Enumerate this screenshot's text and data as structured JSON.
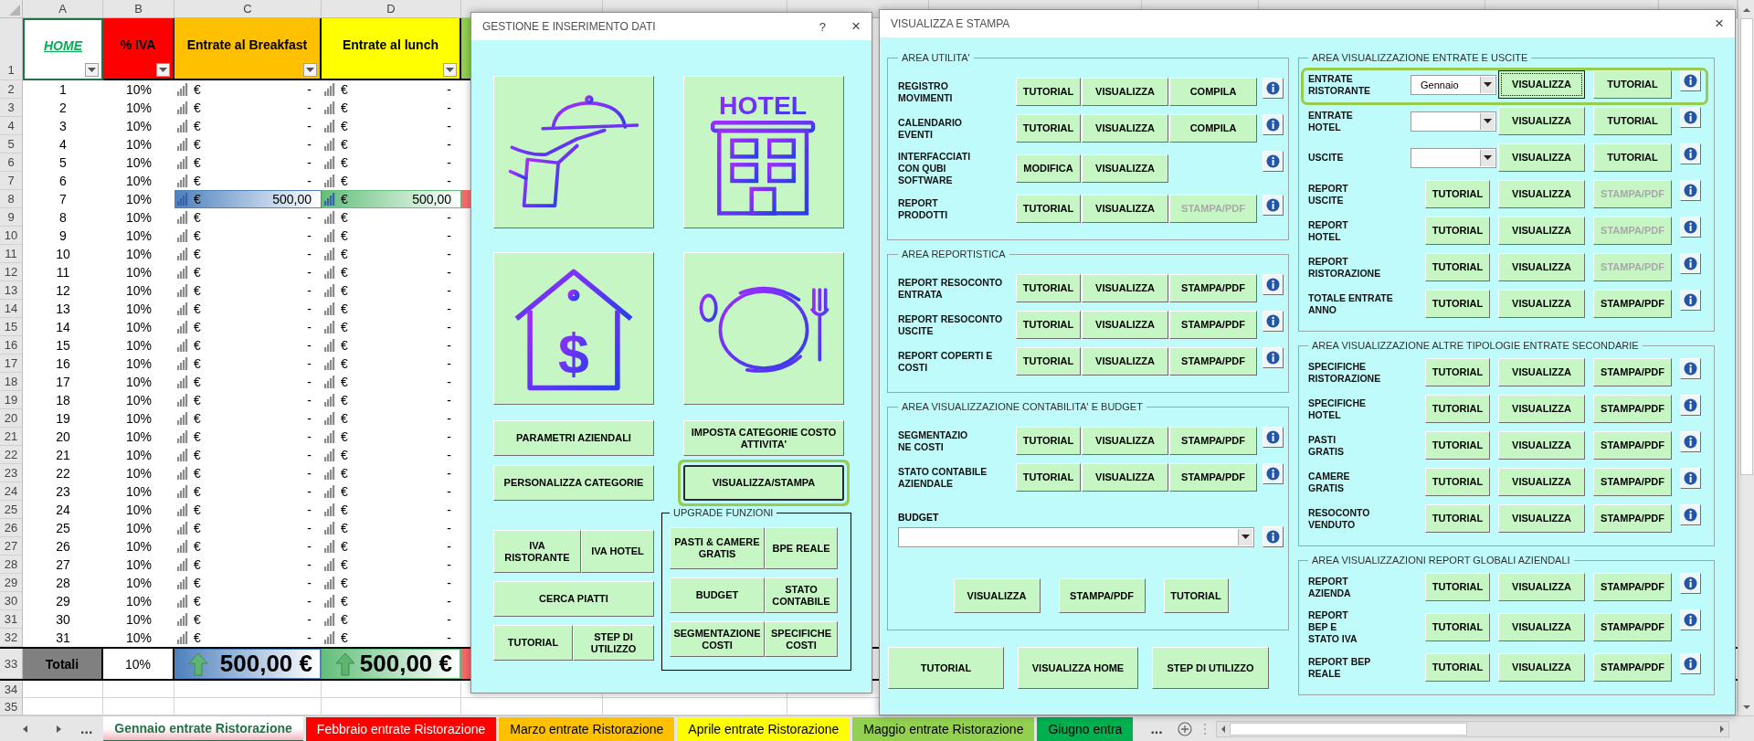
{
  "sheet": {
    "columns": [
      {
        "letter": "A",
        "title": "HOME",
        "color": "#ffffff",
        "selected": true
      },
      {
        "letter": "B",
        "title": "% IVA",
        "color": "#ff0000",
        "selected": false
      },
      {
        "letter": "C",
        "title": "Entrate al Breakfast",
        "color": "#ffc000",
        "selected": false
      },
      {
        "letter": "D",
        "title": "Entrate al lunch",
        "color": "#ffff00",
        "selected": false
      },
      {
        "color": "#92d050",
        "selected": false
      }
    ],
    "header_row": "1",
    "rows": [
      {
        "n": "2",
        "a": "1",
        "b": "10%",
        "c": [
          "€",
          "-"
        ],
        "d": [
          "€",
          "-"
        ],
        "data_bar": false
      },
      {
        "n": "3",
        "a": "2",
        "b": "10%",
        "c": [
          "€",
          "-"
        ],
        "d": [
          "€",
          "-"
        ],
        "data_bar": false
      },
      {
        "n": "4",
        "a": "3",
        "b": "10%",
        "c": [
          "€",
          "-"
        ],
        "d": [
          "€",
          "-"
        ],
        "data_bar": false
      },
      {
        "n": "5",
        "a": "4",
        "b": "10%",
        "c": [
          "€",
          "-"
        ],
        "d": [
          "€",
          "-"
        ],
        "data_bar": false
      },
      {
        "n": "6",
        "a": "5",
        "b": "10%",
        "c": [
          "€",
          "-"
        ],
        "d": [
          "€",
          "-"
        ],
        "data_bar": false
      },
      {
        "n": "7",
        "a": "6",
        "b": "10%",
        "c": [
          "€",
          "-"
        ],
        "d": [
          "€",
          "-"
        ],
        "data_bar": false
      },
      {
        "n": "8",
        "a": "7",
        "b": "10%",
        "c": [
          "€",
          "500,00"
        ],
        "d": [
          "€",
          "500,00"
        ],
        "data_bar": true
      },
      {
        "n": "9",
        "a": "8",
        "b": "10%",
        "c": [
          "€",
          "-"
        ],
        "d": [
          "€",
          "-"
        ],
        "data_bar": false
      },
      {
        "n": "10",
        "a": "9",
        "b": "10%",
        "c": [
          "€",
          "-"
        ],
        "d": [
          "€",
          "-"
        ],
        "data_bar": false
      },
      {
        "n": "11",
        "a": "10",
        "b": "10%",
        "c": [
          "€",
          "-"
        ],
        "d": [
          "€",
          "-"
        ],
        "data_bar": false
      },
      {
        "n": "12",
        "a": "11",
        "b": "10%",
        "c": [
          "€",
          "-"
        ],
        "d": [
          "€",
          "-"
        ],
        "data_bar": false
      },
      {
        "n": "13",
        "a": "12",
        "b": "10%",
        "c": [
          "€",
          "-"
        ],
        "d": [
          "€",
          "-"
        ],
        "data_bar": false
      },
      {
        "n": "14",
        "a": "13",
        "b": "10%",
        "c": [
          "€",
          "-"
        ],
        "d": [
          "€",
          "-"
        ],
        "data_bar": false
      },
      {
        "n": "15",
        "a": "14",
        "b": "10%",
        "c": [
          "€",
          "-"
        ],
        "d": [
          "€",
          "-"
        ],
        "data_bar": false
      },
      {
        "n": "16",
        "a": "15",
        "b": "10%",
        "c": [
          "€",
          "-"
        ],
        "d": [
          "€",
          "-"
        ],
        "data_bar": false
      },
      {
        "n": "17",
        "a": "16",
        "b": "10%",
        "c": [
          "€",
          "-"
        ],
        "d": [
          "€",
          "-"
        ],
        "data_bar": false
      },
      {
        "n": "18",
        "a": "17",
        "b": "10%",
        "c": [
          "€",
          "-"
        ],
        "d": [
          "€",
          "-"
        ],
        "data_bar": false
      },
      {
        "n": "19",
        "a": "18",
        "b": "10%",
        "c": [
          "€",
          "-"
        ],
        "d": [
          "€",
          "-"
        ],
        "data_bar": false
      },
      {
        "n": "20",
        "a": "19",
        "b": "10%",
        "c": [
          "€",
          "-"
        ],
        "d": [
          "€",
          "-"
        ],
        "data_bar": false
      },
      {
        "n": "21",
        "a": "20",
        "b": "10%",
        "c": [
          "€",
          "-"
        ],
        "d": [
          "€",
          "-"
        ],
        "data_bar": false
      },
      {
        "n": "22",
        "a": "21",
        "b": "10%",
        "c": [
          "€",
          "-"
        ],
        "d": [
          "€",
          "-"
        ],
        "data_bar": false
      },
      {
        "n": "23",
        "a": "22",
        "b": "10%",
        "c": [
          "€",
          "-"
        ],
        "d": [
          "€",
          "-"
        ],
        "data_bar": false
      },
      {
        "n": "24",
        "a": "23",
        "b": "10%",
        "c": [
          "€",
          "-"
        ],
        "d": [
          "€",
          "-"
        ],
        "data_bar": false
      },
      {
        "n": "25",
        "a": "24",
        "b": "10%",
        "c": [
          "€",
          "-"
        ],
        "d": [
          "€",
          "-"
        ],
        "data_bar": false
      },
      {
        "n": "26",
        "a": "25",
        "b": "10%",
        "c": [
          "€",
          "-"
        ],
        "d": [
          "€",
          "-"
        ],
        "data_bar": false
      },
      {
        "n": "27",
        "a": "26",
        "b": "10%",
        "c": [
          "€",
          "-"
        ],
        "d": [
          "€",
          "-"
        ],
        "data_bar": false
      },
      {
        "n": "28",
        "a": "27",
        "b": "10%",
        "c": [
          "€",
          "-"
        ],
        "d": [
          "€",
          "-"
        ],
        "data_bar": false
      },
      {
        "n": "29",
        "a": "28",
        "b": "10%",
        "c": [
          "€",
          "-"
        ],
        "d": [
          "€",
          "-"
        ],
        "data_bar": false
      },
      {
        "n": "30",
        "a": "29",
        "b": "10%",
        "c": [
          "€",
          "-"
        ],
        "d": [
          "€",
          "-"
        ],
        "data_bar": false
      },
      {
        "n": "31",
        "a": "30",
        "b": "10%",
        "c": [
          "€",
          "-"
        ],
        "d": [
          "€",
          "-"
        ],
        "data_bar": false
      },
      {
        "n": "32",
        "a": "31",
        "b": "10%",
        "c": [
          "€",
          "-"
        ],
        "d": [
          "€",
          "-"
        ],
        "data_bar": false
      }
    ],
    "totals": {
      "n": "33",
      "label": "Totali",
      "vat": "10%",
      "amounts": [
        "500,00 €",
        "500,00 €"
      ]
    },
    "blank_rows": [
      "34",
      "35"
    ],
    "tab_more_left": "...",
    "tabs": [
      {
        "label": "Gennaio entrate Ristorazione",
        "color": "#f4b6c2",
        "selected": true
      },
      {
        "label": "Febbraio entrate Ristorazione",
        "color": "#ff0000",
        "selected": false
      },
      {
        "label": "Marzo entrate Ristorazione",
        "color": "#ffc000",
        "selected": false
      },
      {
        "label": "Aprile entrate Ristorazione",
        "color": "#ffff00",
        "selected": false
      },
      {
        "label": "Maggio entrate Ristorazione",
        "color": "#92d050",
        "selected": false
      },
      {
        "label": "Giugno entra",
        "color": "#00b050",
        "selected": false
      }
    ],
    "tab_more_right": "..."
  },
  "data_entry_dialog": {
    "title": "GESTIONE E INSERIMENTO DATI",
    "help": "?",
    "close": "×",
    "tiles": [
      {
        "kind": "waiter"
      },
      {
        "kind": "hotel",
        "icon_text": "HOTEL"
      },
      {
        "kind": "house",
        "icon_text": "$"
      },
      {
        "kind": "plate"
      }
    ],
    "buttons": [
      {
        "label": "PARAMETRI AZIENDALI",
        "focused": false
      },
      {
        "label": "IMPOSTA CATEGORIE COSTO\nATTIVITA'",
        "focused": false
      },
      {
        "label": "PERSONALIZZA CATEGORIE",
        "focused": false
      },
      {
        "label": "VISUALIZZA/STAMPA",
        "focused": true
      }
    ],
    "left_rows": [
      [
        {
          "label": "IVA\nRISTORANTE"
        },
        {
          "label": "IVA HOTEL"
        }
      ],
      [
        {
          "label": "CERCA PIATTI"
        }
      ],
      [
        {
          "label": "TUTORIAL"
        },
        {
          "label": "STEP DI\nUTILIZZO"
        }
      ]
    ],
    "upgrade": {
      "title": "UPGRADE FUNZIONI",
      "rows": [
        [
          {
            "label": "PASTI & CAMERE\nGRATIS"
          },
          {
            "label": "BPE REALE"
          }
        ],
        [
          {
            "label": "BUDGET"
          },
          {
            "label": "STATO\nCONTABILE"
          }
        ],
        [
          {
            "label": "SEGMENTAZIONE\nCOSTI"
          },
          {
            "label": "SPECIFICHE\nCOSTI"
          }
        ]
      ]
    }
  },
  "view_print_dialog": {
    "title": "VISUALIZZA E STAMPA",
    "close": "×",
    "left_groups": [
      {
        "title": "AREA UTILITA'",
        "rows": [
          {
            "kind": "actions",
            "label": "REGISTRO\nMOVIMENTI",
            "highlighted": false,
            "buttons": [
              {
                "label": "TUTORIAL",
                "disabled": false,
                "focused": false
              },
              {
                "label": "VISUALIZZA",
                "disabled": false,
                "focused": false
              },
              {
                "label": "COMPILA",
                "disabled": false,
                "focused": false
              }
            ]
          },
          {
            "kind": "actions",
            "label": "CALENDARIO\nEVENTI",
            "highlighted": false,
            "buttons": [
              {
                "label": "TUTORIAL",
                "disabled": false,
                "focused": false
              },
              {
                "label": "VISUALIZZA",
                "disabled": false,
                "focused": false
              },
              {
                "label": "COMPILA",
                "disabled": false,
                "focused": false
              }
            ]
          },
          {
            "kind": "actions",
            "label": "INTERFACCIATI\nCON QUBI\nSOFTWARE",
            "highlighted": false,
            "buttons": [
              {
                "label": "MODIFICA",
                "disabled": false,
                "focused": false
              },
              {
                "label": "VISUALIZZA",
                "disabled": false,
                "focused": false
              }
            ]
          },
          {
            "kind": "actions",
            "label": "REPORT\nPRODOTTI",
            "highlighted": false,
            "buttons": [
              {
                "label": "TUTORIAL",
                "disabled": false,
                "focused": false
              },
              {
                "label": "VISUALIZZA",
                "disabled": false,
                "focused": false
              },
              {
                "label": "STAMPA/PDF",
                "disabled": true,
                "focused": false
              }
            ]
          }
        ]
      },
      {
        "title": "AREA REPORTISTICA",
        "rows": [
          {
            "kind": "actions",
            "label": "REPORT RESOCONTO\nENTRATA",
            "highlighted": false,
            "buttons": [
              {
                "label": "TUTORIAL",
                "disabled": false,
                "focused": false
              },
              {
                "label": "VISUALIZZA",
                "disabled": false,
                "focused": false
              },
              {
                "label": "STAMPA/PDF",
                "disabled": false,
                "focused": false
              }
            ]
          },
          {
            "kind": "actions",
            "label": "REPORT RESOCONTO\nUSCITE",
            "highlighted": false,
            "buttons": [
              {
                "label": "TUTORIAL",
                "disabled": false,
                "focused": false
              },
              {
                "label": "VISUALIZZA",
                "disabled": false,
                "focused": false
              },
              {
                "label": "STAMPA/PDF",
                "disabled": false,
                "focused": false
              }
            ]
          },
          {
            "kind": "actions",
            "label": "REPORT COPERTI E\nCOSTI",
            "highlighted": false,
            "buttons": [
              {
                "label": "TUTORIAL",
                "disabled": false,
                "focused": false
              },
              {
                "label": "VISUALIZZA",
                "disabled": false,
                "focused": false
              },
              {
                "label": "STAMPA/PDF",
                "disabled": false,
                "focused": false
              }
            ]
          }
        ]
      },
      {
        "title": "AREA VISUALIZZAZIONE CONTABILITA' E BUDGET",
        "rows": [
          {
            "kind": "actions",
            "label": "SEGMENTAZIO\nNE COSTI",
            "highlighted": false,
            "buttons": [
              {
                "label": "TUTORIAL",
                "disabled": false,
                "focused": false
              },
              {
                "label": "VISUALIZZA",
                "disabled": false,
                "focused": false
              },
              {
                "label": "STAMPA/PDF",
                "disabled": false,
                "focused": false
              }
            ]
          },
          {
            "kind": "actions",
            "label": "STATO CONTABILE\nAZIENDALE",
            "highlighted": false,
            "buttons": [
              {
                "label": "TUTORIAL",
                "disabled": false,
                "focused": false
              },
              {
                "label": "VISUALIZZA",
                "disabled": false,
                "focused": false
              },
              {
                "label": "STAMPA/PDF",
                "disabled": false,
                "focused": false
              }
            ]
          }
        ],
        "budget": {
          "label": "BUDGET",
          "buttons": [
            {
              "label": "VISUALIZZA"
            },
            {
              "label": "STAMPA/PDF"
            },
            {
              "label": "TUTORIAL"
            }
          ]
        }
      }
    ],
    "bottom_buttons": [
      {
        "label": "TUTORIAL"
      },
      {
        "label": "VISUALIZZA HOME"
      },
      {
        "label": "STEP DI UTILIZZO"
      }
    ],
    "right_groups": [
      {
        "title": "AREA VISUALIZZAZIONE ENTRATE E USCITE",
        "rows": [
          {
            "kind": "select",
            "label": "ENTRATE\nRISTORANTE",
            "value": "Gennaio",
            "highlighted": true,
            "buttons": [
              {
                "label": "VISUALIZZA",
                "disabled": false,
                "focused": true
              },
              {
                "label": "TUTORIAL",
                "disabled": false,
                "focused": false
              }
            ]
          },
          {
            "kind": "select",
            "label": "ENTRATE\nHOTEL",
            "highlighted": false,
            "buttons": [
              {
                "label": "VISUALIZZA",
                "disabled": false,
                "focused": false
              },
              {
                "label": "TUTORIAL",
                "disabled": false,
                "focused": false
              }
            ]
          },
          {
            "kind": "select",
            "label": "USCITE",
            "highlighted": false,
            "buttons": [
              {
                "label": "VISUALIZZA",
                "disabled": false,
                "focused": false
              },
              {
                "label": "TUTORIAL",
                "disabled": false,
                "focused": false
              }
            ]
          },
          {
            "kind": "actions",
            "label": "REPORT\nUSCITE",
            "highlighted": false,
            "buttons": [
              {
                "label": "TUTORIAL",
                "disabled": false,
                "focused": false
              },
              {
                "label": "VISUALIZZA",
                "disabled": false,
                "focused": false
              },
              {
                "label": "STAMPA/PDF",
                "disabled": true,
                "focused": false
              }
            ]
          },
          {
            "kind": "actions",
            "label": "REPORT\nHOTEL",
            "highlighted": false,
            "buttons": [
              {
                "label": "TUTORIAL",
                "disabled": false,
                "focused": false
              },
              {
                "label": "VISUALIZZA",
                "disabled": false,
                "focused": false
              },
              {
                "label": "STAMPA/PDF",
                "disabled": true,
                "focused": false
              }
            ]
          },
          {
            "kind": "actions",
            "label": "REPORT\nRISTORAZIONE",
            "highlighted": false,
            "buttons": [
              {
                "label": "TUTORIAL",
                "disabled": false,
                "focused": false
              },
              {
                "label": "VISUALIZZA",
                "disabled": false,
                "focused": false
              },
              {
                "label": "STAMPA/PDF",
                "disabled": true,
                "focused": false
              }
            ]
          },
          {
            "kind": "actions",
            "label": "TOTALE ENTRATE\nANNO",
            "highlighted": false,
            "buttons": [
              {
                "label": "TUTORIAL",
                "disabled": false,
                "focused": false
              },
              {
                "label": "VISUALIZZA",
                "disabled": false,
                "focused": false
              },
              {
                "label": "STAMPA/PDF",
                "disabled": false,
                "focused": false
              }
            ]
          }
        ]
      },
      {
        "title": "AREA VISUALIZZAZIONE ALTRE TIPOLOGIE ENTRATE SECONDARIE",
        "rows": [
          {
            "kind": "actions",
            "label": "SPECIFICHE\nRISTORAZIONE",
            "highlighted": false,
            "buttons": [
              {
                "label": "TUTORIAL",
                "disabled": false,
                "focused": false
              },
              {
                "label": "VISUALIZZA",
                "disabled": false,
                "focused": false
              },
              {
                "label": "STAMPA/PDF",
                "disabled": false,
                "focused": false
              }
            ]
          },
          {
            "kind": "actions",
            "label": "SPECIFICHE\nHOTEL",
            "highlighted": false,
            "buttons": [
              {
                "label": "TUTORIAL",
                "disabled": false,
                "focused": false
              },
              {
                "label": "VISUALIZZA",
                "disabled": false,
                "focused": false
              },
              {
                "label": "STAMPA/PDF",
                "disabled": false,
                "focused": false
              }
            ]
          },
          {
            "kind": "actions",
            "label": "PASTI\nGRATIS",
            "highlighted": false,
            "buttons": [
              {
                "label": "TUTORIAL",
                "disabled": false,
                "focused": false
              },
              {
                "label": "VISUALIZZA",
                "disabled": false,
                "focused": false
              },
              {
                "label": "STAMPA/PDF",
                "disabled": false,
                "focused": false
              }
            ]
          },
          {
            "kind": "actions",
            "label": "CAMERE\nGRATIS",
            "highlighted": false,
            "buttons": [
              {
                "label": "TUTORIAL",
                "disabled": false,
                "focused": false
              },
              {
                "label": "VISUALIZZA",
                "disabled": false,
                "focused": false
              },
              {
                "label": "STAMPA/PDF",
                "disabled": false,
                "focused": false
              }
            ]
          },
          {
            "kind": "actions",
            "label": "RESOCONTO\nVENDUTO",
            "highlighted": false,
            "buttons": [
              {
                "label": "TUTORIAL",
                "disabled": false,
                "focused": false
              },
              {
                "label": "VISUALIZZA",
                "disabled": false,
                "focused": false
              },
              {
                "label": "STAMPA/PDF",
                "disabled": false,
                "focused": false
              }
            ]
          }
        ]
      },
      {
        "title": "AREA VISUALIZZAZIONI REPORT GLOBALI AZIENDALI",
        "rows": [
          {
            "kind": "actions",
            "label": "REPORT\nAZIENDA",
            "highlighted": false,
            "buttons": [
              {
                "label": "TUTORIAL",
                "disabled": false,
                "focused": false
              },
              {
                "label": "VISUALIZZA",
                "disabled": false,
                "focused": false
              },
              {
                "label": "STAMPA/PDF",
                "disabled": false,
                "focused": false
              }
            ]
          },
          {
            "kind": "actions",
            "label": "REPORT\nBEP E\nSTATO IVA",
            "highlighted": false,
            "buttons": [
              {
                "label": "TUTORIAL",
                "disabled": false,
                "focused": false
              },
              {
                "label": "VISUALIZZA",
                "disabled": false,
                "focused": false
              },
              {
                "label": "STAMPA/PDF",
                "disabled": false,
                "focused": false
              }
            ]
          },
          {
            "kind": "actions",
            "label": "REPORT BEP\nREALE",
            "highlighted": false,
            "buttons": [
              {
                "label": "TUTORIAL",
                "disabled": false,
                "focused": false
              },
              {
                "label": "VISUALIZZA",
                "disabled": false,
                "focused": false
              },
              {
                "label": "STAMPA/PDF",
                "disabled": false,
                "focused": false
              }
            ]
          }
        ]
      }
    ]
  }
}
